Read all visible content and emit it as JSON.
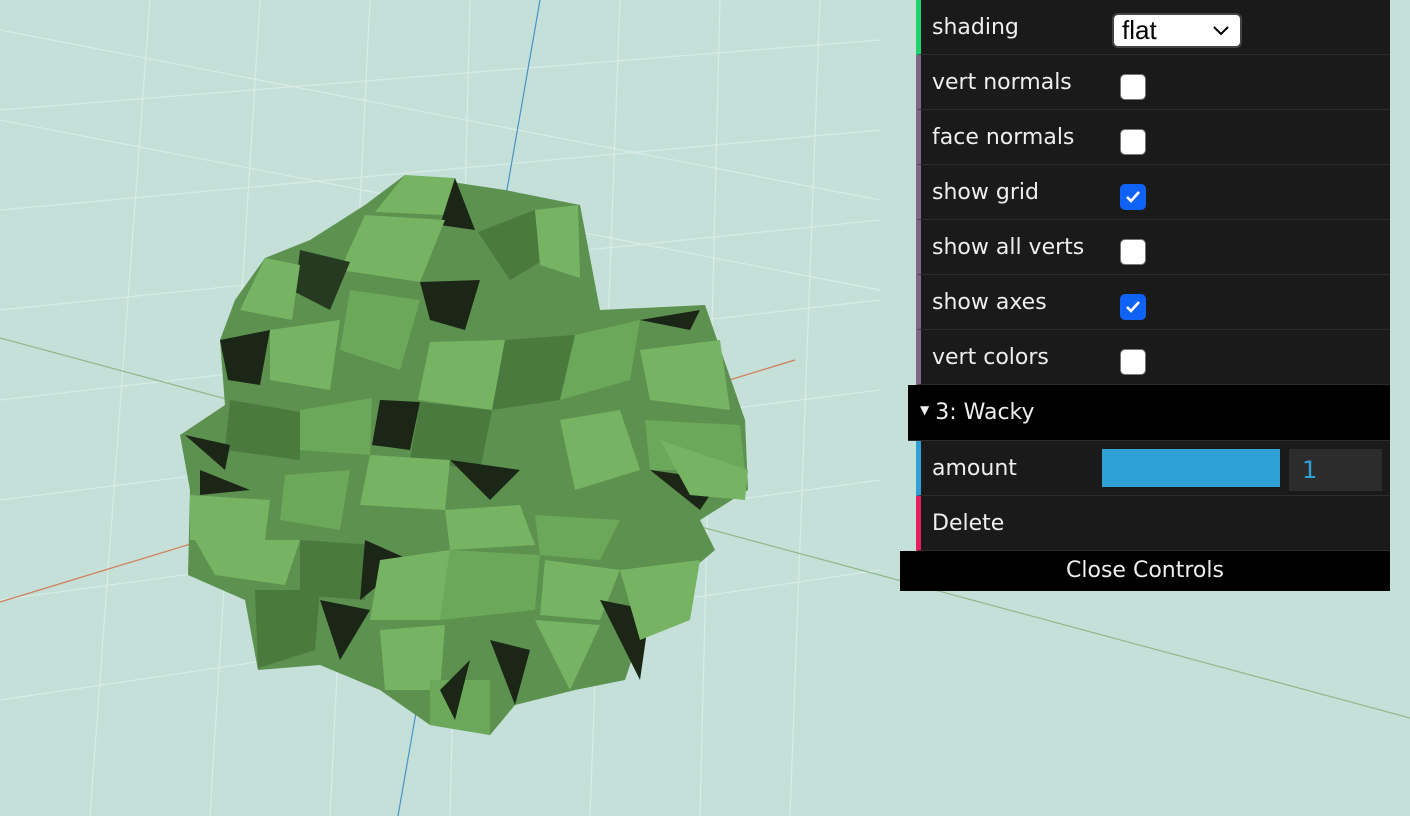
{
  "controls": {
    "shading": {
      "label": "shading",
      "value": "flat"
    },
    "vert_normals": {
      "label": "vert normals",
      "checked": false
    },
    "face_normals": {
      "label": "face normals",
      "checked": false
    },
    "show_grid": {
      "label": "show grid",
      "checked": true
    },
    "show_all_verts": {
      "label": "show all verts",
      "checked": false
    },
    "show_axes": {
      "label": "show axes",
      "checked": true
    },
    "vert_colors": {
      "label": "vert colors",
      "checked": false
    }
  },
  "folder": {
    "title": "3: Wacky",
    "amount": {
      "label": "amount",
      "value": "1"
    },
    "delete_label": "Delete"
  },
  "close_label": "Close Controls",
  "colors": {
    "background": "#c5e0d8",
    "mesh_light": "#76b464",
    "mesh_mid": "#5d914f",
    "mesh_dark": "#1b2617",
    "panel": "#1a1a1a",
    "accent_blue": "#2fa1d6",
    "accent_green": "#1ed36f",
    "accent_red": "#e61d5f",
    "checkbox_on": "#1062f5"
  },
  "icons": {
    "dropdown": "chevron-down-icon",
    "folder": "triangle-down-icon",
    "checkmark": "checkmark-icon"
  }
}
